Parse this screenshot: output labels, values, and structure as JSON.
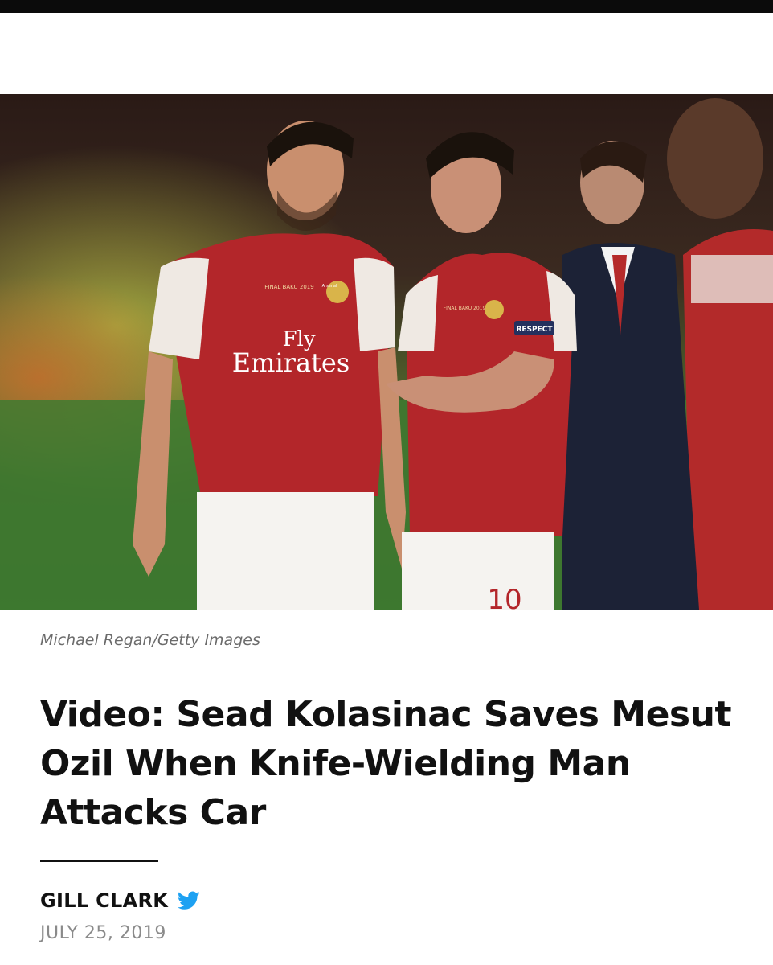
{
  "photo": {
    "credit": "Michael Regan/Getty Images",
    "shirt_sponsor_line1": "Fly",
    "shirt_sponsor_line2": "Emirates",
    "shirt_badge": "Arsenal",
    "sleeve_patch": "RESPECT",
    "shirt_number": "10",
    "match_print": "FINAL BAKU 2019"
  },
  "article": {
    "headline": "Video: Sead Kolasinac Saves Mesut Ozil When Knife-Wielding Man Attacks Car",
    "author": "GILL CLARK",
    "date": "JULY 25, 2019"
  },
  "icons": {
    "author_social": "twitter-icon"
  },
  "colors": {
    "twitter": "#1da1f2",
    "kit_red": "#b3262a",
    "pitch": "#3d7a2e"
  }
}
